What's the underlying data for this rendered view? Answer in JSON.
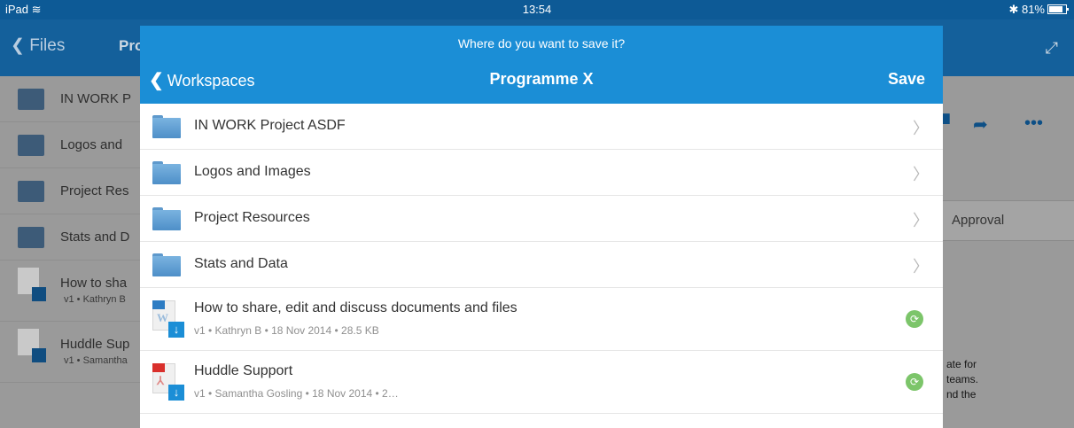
{
  "status_bar": {
    "device": "iPad",
    "wifi_icon": "wifi-icon",
    "time": "13:54",
    "bluetooth_icon": "bluetooth-icon",
    "battery": "81%"
  },
  "background_app": {
    "back_label": "Files",
    "title_fragment": "Pro",
    "rows": [
      {
        "label": "IN WORK P"
      },
      {
        "label": "Logos and"
      },
      {
        "label": "Project Res"
      },
      {
        "label": "Stats and D"
      },
      {
        "label": "How to sha",
        "meta": "v1 • Kathryn B"
      },
      {
        "label": "Huddle Sup",
        "meta": "v1 • Samantha"
      }
    ],
    "approval_fragment": "Approval",
    "text_fragments": [
      "ate for",
      "teams.",
      "nd the"
    ]
  },
  "modal": {
    "prompt": "Where do you want to save it?",
    "back_label": "Workspaces",
    "title": "Programme X",
    "save_label": "Save",
    "folders": [
      {
        "name": "IN WORK Project ASDF"
      },
      {
        "name": "Logos and Images"
      },
      {
        "name": "Project Resources"
      },
      {
        "name": "Stats and Data"
      }
    ],
    "files": [
      {
        "name": "How to share, edit and discuss documents and files",
        "meta": "v1 • Kathryn B • 18 Nov 2014 • 28.5 KB",
        "type": "word",
        "glyph": "W",
        "color": "#2d7cc3"
      },
      {
        "name": "Huddle Support",
        "meta": "v1 • Samantha Gosling • 18 Nov 2014 • 2…",
        "type": "pdf",
        "glyph": "⅄",
        "color": "#d9302c"
      }
    ]
  },
  "colors": {
    "nav_blue": "#1b8ed6",
    "status_blue": "#0d5a96",
    "sync_green": "#7cc56a"
  }
}
